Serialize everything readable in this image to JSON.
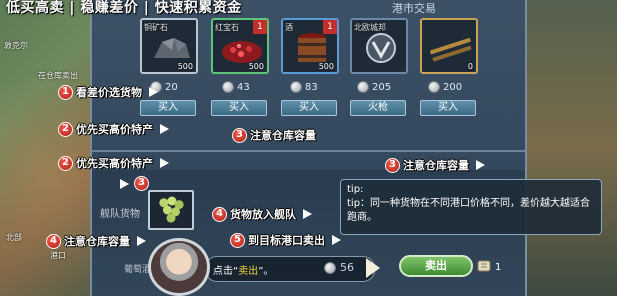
{
  "headline": "低买高卖 | 稳赚差价 | 快速积累资金",
  "panel_title": "港市交易",
  "goods": [
    {
      "name": "铜矿石",
      "qty": "500",
      "price": "20",
      "buy": "买入",
      "badge": "",
      "icon": "copper-ore-icon"
    },
    {
      "name": "红宝石",
      "qty": "500",
      "price": "43",
      "buy": "买入",
      "badge": "1",
      "icon": "ruby-icon"
    },
    {
      "name": "酒",
      "qty": "500",
      "price": "83",
      "buy": "买入",
      "badge": "1",
      "icon": "wine-barrel-icon"
    },
    {
      "name": "北欧城邦",
      "qty": "",
      "price": "205",
      "buy": "火枪",
      "badge": "",
      "icon": "emblem-icon"
    },
    {
      "name": "",
      "qty": "0",
      "price": "200",
      "buy": "买入",
      "badge": "",
      "icon": "musket-icon"
    }
  ],
  "steps": {
    "s1a": {
      "num": "1",
      "text": "看差价选货物"
    },
    "s2a": {
      "num": "2",
      "text": "优先买高价特产"
    },
    "s3a": {
      "num": "3",
      "text": "注意仓库容量"
    },
    "s2b": {
      "num": "2",
      "text": "优先买高价特产"
    },
    "s3b": {
      "num": "3",
      "text": "注意仓库容量"
    },
    "s3c": {
      "num": "3",
      "text": ""
    },
    "s4a": {
      "num": "4",
      "text": "货物放入舰队"
    },
    "s4b": {
      "num": "4",
      "text": "注意仓库容量"
    },
    "s5": {
      "num": "5",
      "text": "到目标港口卖出"
    }
  },
  "fleet": {
    "label": "舰队货物",
    "capacity": "葡萄酒"
  },
  "tip": {
    "title": "tip:",
    "body": "tip：同一种货物在不同港口价格不同，差价越大越适合跑商。"
  },
  "speech": {
    "prefix": "点击“",
    "highlight": "卖出",
    "suffix": "”。"
  },
  "price_56": "56",
  "sell_label": "卖出",
  "scroll_count": "1",
  "map_texts": [
    "敦克尔",
    "在仓库卖出",
    "北部",
    "港口"
  ]
}
